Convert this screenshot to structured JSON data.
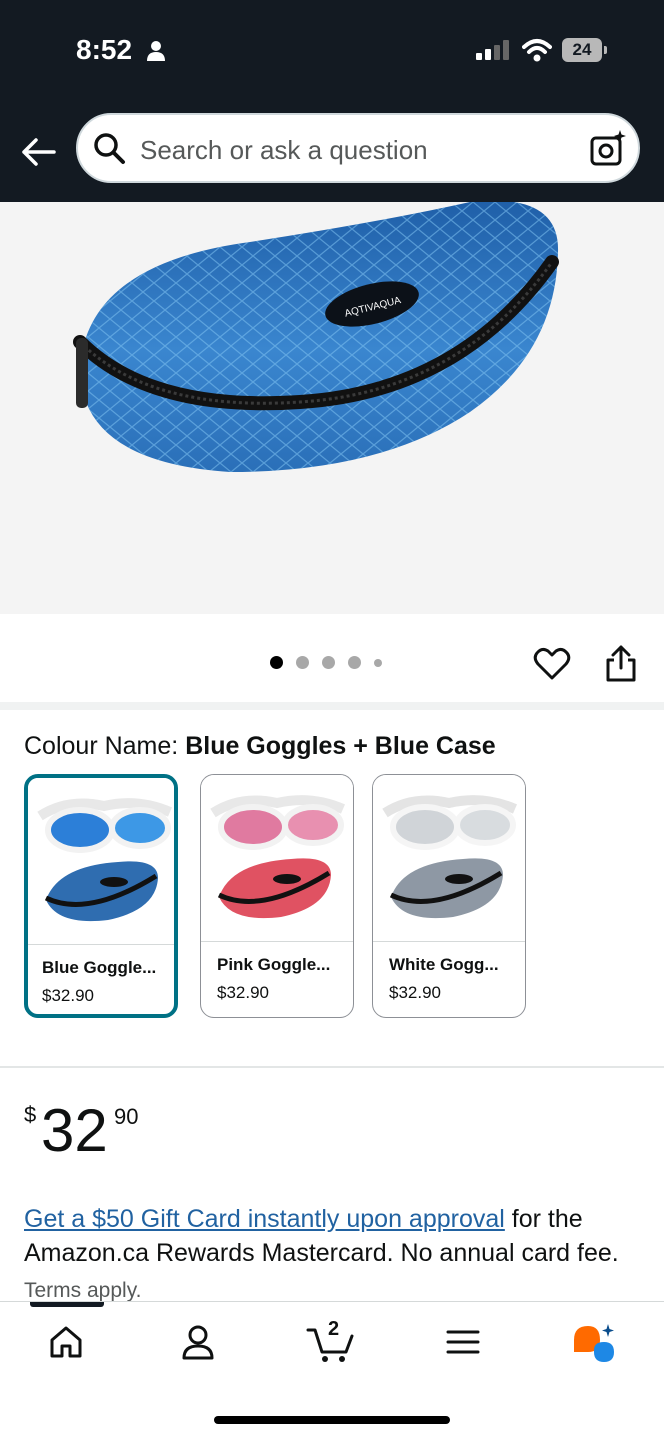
{
  "status_bar": {
    "time": "8:52",
    "battery": "24"
  },
  "search": {
    "placeholder": "Search or ask a question"
  },
  "gallery": {
    "brand_logo": "AQTIVAQUA",
    "dots": 5,
    "active_index": 0
  },
  "colour": {
    "label": "Colour Name:",
    "selected_value": "Blue Goggles + Blue Case",
    "options": [
      {
        "name": "Blue Goggle...",
        "price": "$32.90"
      },
      {
        "name": "Pink Goggle...",
        "price": "$32.90"
      },
      {
        "name": "White Gogg...",
        "price": "$32.90"
      }
    ]
  },
  "price": {
    "symbol": "$",
    "whole": "32",
    "fraction": "90"
  },
  "promo": {
    "link_text": "Get a $50 Gift Card instantly upon approval",
    "body_text": " for the Amazon.ca Rewards Mastercard. No annual card fee.",
    "terms": " Terms apply."
  },
  "bottom_nav": {
    "cart_count": "2"
  },
  "colors": {
    "top_bar": "#131a22",
    "link": "#2162a1",
    "selected_border": "#007185"
  }
}
